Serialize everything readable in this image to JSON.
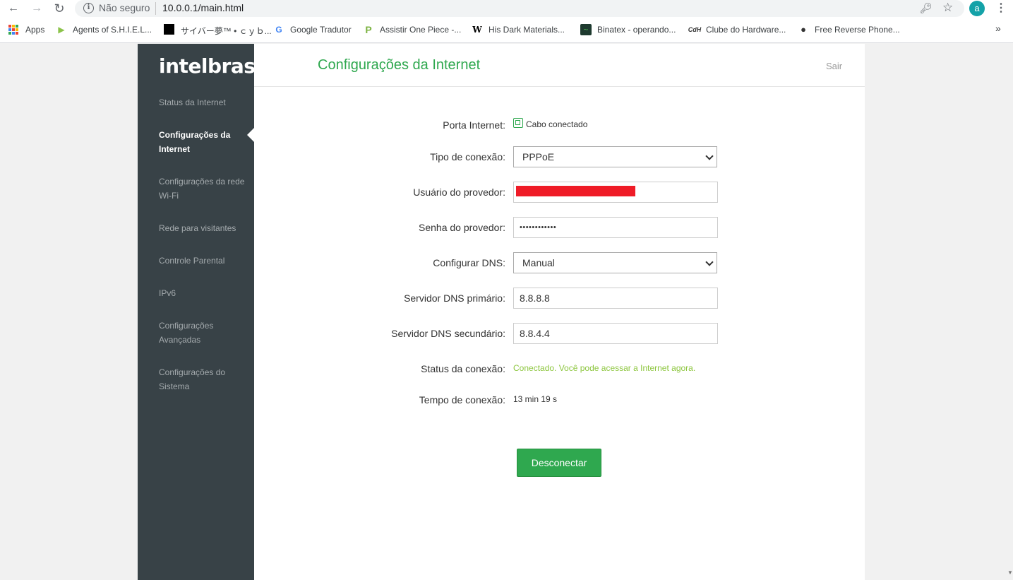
{
  "browser": {
    "security_label": "Não seguro",
    "url": "10.0.0.1/main.html",
    "profile_initial": "a",
    "bookmarks": [
      {
        "label": "Apps"
      },
      {
        "label": "Agents of S.H.I.E.L..."
      },
      {
        "label": "サイバー夢™ • ｃｙｂ..."
      },
      {
        "label": "Google Tradutor"
      },
      {
        "label": "Assistir One Piece -..."
      },
      {
        "label": "His Dark Materials..."
      },
      {
        "label": "Binatex - operando..."
      },
      {
        "label": "Clube do Hardware..."
      },
      {
        "label": "Free Reverse Phone..."
      }
    ]
  },
  "sidebar": {
    "logo": "intelbras",
    "items": [
      {
        "label": "Status da Internet"
      },
      {
        "label": "Configurações da Internet",
        "active": true
      },
      {
        "label": "Configurações da rede Wi-Fi"
      },
      {
        "label": "Rede para visitantes"
      },
      {
        "label": "Controle Parental"
      },
      {
        "label": "IPv6"
      },
      {
        "label": "Configurações Avançadas"
      },
      {
        "label": "Configurações do Sistema"
      }
    ]
  },
  "header": {
    "title": "Configurações da Internet",
    "logout": "Sair"
  },
  "form": {
    "port_label": "Porta Internet:",
    "port_value": "Cabo conectado",
    "connection_type_label": "Tipo de conexão:",
    "connection_type_value": "PPPoE",
    "user_label": "Usuário do provedor:",
    "password_label": "Senha do provedor:",
    "password_value": "••••••••••••",
    "dns_mode_label": "Configurar DNS:",
    "dns_mode_value": "Manual",
    "dns_primary_label": "Servidor DNS primário:",
    "dns_primary_value": "8.8.8.8",
    "dns_secondary_label": "Servidor DNS secundário:",
    "dns_secondary_value": "8.8.4.4",
    "status_label": "Status da conexão:",
    "status_value": "Conectado. Você pode acessar a Internet agora.",
    "time_label": "Tempo de conexão:",
    "time_value": "13 min 19 s",
    "disconnect_label": "Desconectar"
  },
  "colors": {
    "sidebar_bg": "#384247",
    "accent_green": "#2fa84f",
    "status_green": "#8dc63f",
    "redaction": "#ef1c27"
  }
}
